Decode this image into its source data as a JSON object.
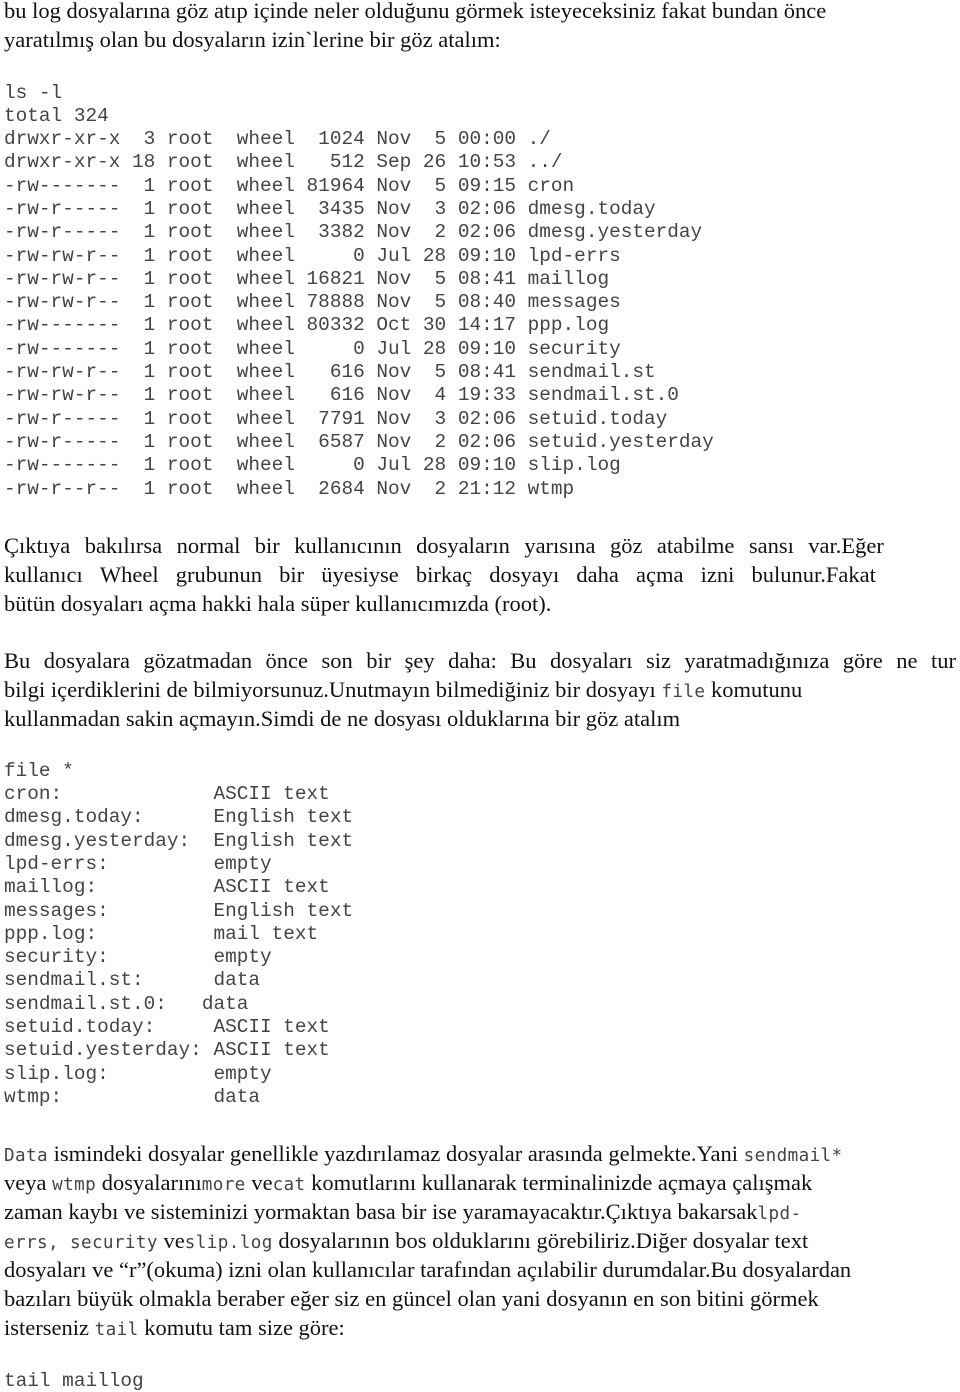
{
  "intro": {
    "line1": "bu log dosyalarına göz atıp içinde neler olduğunu görmek isteyeceksiniz fakat bundan önce",
    "line2": "yaratılmış olan bu dosyaların izin`lerine bir göz atalım:"
  },
  "ls_listing": {
    "command": "ls -l",
    "total": "total 324",
    "rows": [
      {
        "perms": "drwxr-xr-x",
        "links": "3",
        "owner": "root",
        "group": "wheel",
        "size": "1024",
        "month": "Nov",
        "day": "5",
        "time": "00:00",
        "name": "./"
      },
      {
        "perms": "drwxr-xr-x",
        "links": "18",
        "owner": "root",
        "group": "wheel",
        "size": "512",
        "month": "Sep",
        "day": "26",
        "time": "10:53",
        "name": "../"
      },
      {
        "perms": "-rw-------",
        "links": "1",
        "owner": "root",
        "group": "wheel",
        "size": "81964",
        "month": "Nov",
        "day": "5",
        "time": "09:15",
        "name": "cron"
      },
      {
        "perms": "-rw-r-----",
        "links": "1",
        "owner": "root",
        "group": "wheel",
        "size": "3435",
        "month": "Nov",
        "day": "3",
        "time": "02:06",
        "name": "dmesg.today"
      },
      {
        "perms": "-rw-r-----",
        "links": "1",
        "owner": "root",
        "group": "wheel",
        "size": "3382",
        "month": "Nov",
        "day": "2",
        "time": "02:06",
        "name": "dmesg.yesterday"
      },
      {
        "perms": "-rw-rw-r--",
        "links": "1",
        "owner": "root",
        "group": "wheel",
        "size": "0",
        "month": "Jul",
        "day": "28",
        "time": "09:10",
        "name": "lpd-errs"
      },
      {
        "perms": "-rw-rw-r--",
        "links": "1",
        "owner": "root",
        "group": "wheel",
        "size": "16821",
        "month": "Nov",
        "day": "5",
        "time": "08:41",
        "name": "maillog"
      },
      {
        "perms": "-rw-rw-r--",
        "links": "1",
        "owner": "root",
        "group": "wheel",
        "size": "78888",
        "month": "Nov",
        "day": "5",
        "time": "08:40",
        "name": "messages"
      },
      {
        "perms": "-rw-------",
        "links": "1",
        "owner": "root",
        "group": "wheel",
        "size": "80332",
        "month": "Oct",
        "day": "30",
        "time": "14:17",
        "name": "ppp.log"
      },
      {
        "perms": "-rw-------",
        "links": "1",
        "owner": "root",
        "group": "wheel",
        "size": "0",
        "month": "Jul",
        "day": "28",
        "time": "09:10",
        "name": "security"
      },
      {
        "perms": "-rw-rw-r--",
        "links": "1",
        "owner": "root",
        "group": "wheel",
        "size": "616",
        "month": "Nov",
        "day": "5",
        "time": "08:41",
        "name": "sendmail.st"
      },
      {
        "perms": "-rw-rw-r--",
        "links": "1",
        "owner": "root",
        "group": "wheel",
        "size": "616",
        "month": "Nov",
        "day": "4",
        "time": "19:33",
        "name": "sendmail.st.0"
      },
      {
        "perms": "-rw-r-----",
        "links": "1",
        "owner": "root",
        "group": "wheel",
        "size": "7791",
        "month": "Nov",
        "day": "3",
        "time": "02:06",
        "name": "setuid.today"
      },
      {
        "perms": "-rw-r-----",
        "links": "1",
        "owner": "root",
        "group": "wheel",
        "size": "6587",
        "month": "Nov",
        "day": "2",
        "time": "02:06",
        "name": "setuid.yesterday"
      },
      {
        "perms": "-rw-------",
        "links": "1",
        "owner": "root",
        "group": "wheel",
        "size": "0",
        "month": "Jul",
        "day": "28",
        "time": "09:10",
        "name": "slip.log"
      },
      {
        "perms": "-rw-r--r--",
        "links": "1",
        "owner": "root",
        "group": "wheel",
        "size": "2684",
        "month": "Nov",
        "day": "2",
        "time": "21:12",
        "name": "wtmp"
      }
    ]
  },
  "para1": {
    "line1": [
      "Çıktıya",
      "bakılırsa",
      "normal",
      "bir",
      "kullanıcının",
      "dosyaların",
      "yarısına",
      "göz",
      "atabilme",
      "sansı",
      "var.Eğer"
    ],
    "line2": [
      "kullanıcı",
      "Wheel",
      "grubunun",
      "bir",
      "üyesiyse",
      "birkaç",
      "dosyayı",
      "daha",
      "açma",
      "izni",
      "bulunur.Fakat"
    ],
    "line3": "bütün dosyaları açma hakki hala süper kullanıcımızda (root)."
  },
  "para2": {
    "line1": [
      "Bu",
      "dosyalara",
      "gözatmadan",
      "önce",
      "son",
      "bir",
      "şey",
      "daha:",
      "Bu",
      "dosyaları",
      "siz",
      "yaratmadığınıza",
      "göre",
      "ne",
      "tur"
    ],
    "line2_a": "bilgi içerdiklerini de bilmiyorsunuz.Unutmayın bilmediğiniz bir dosyayı ",
    "line2_code": "file",
    "line2_b": " komutunu",
    "line3": "kullanmadan sakin açmayın.Simdi de ne dosyası olduklarına bir göz atalım"
  },
  "file_listing": {
    "command": "file *",
    "rows": [
      {
        "name": "cron:",
        "type": "ASCII text"
      },
      {
        "name": "dmesg.today:",
        "type": "English text"
      },
      {
        "name": "dmesg.yesterday:",
        "type": "English text"
      },
      {
        "name": "lpd-errs:",
        "type": "empty"
      },
      {
        "name": "maillog:",
        "type": "ASCII text"
      },
      {
        "name": "messages:",
        "type": "English text"
      },
      {
        "name": "ppp.log:",
        "type": "mail text"
      },
      {
        "name": "security:",
        "type": "empty"
      },
      {
        "name": "sendmail.st:",
        "type": "data"
      },
      {
        "name": "sendmail.st.0:",
        "type": "data"
      },
      {
        "name": "setuid.today:",
        "type": "ASCII text"
      },
      {
        "name": "setuid.yesterday:",
        "type": "ASCII text"
      },
      {
        "name": "slip.log:",
        "type": "empty"
      },
      {
        "name": "wtmp:",
        "type": "data"
      }
    ]
  },
  "para3": {
    "l1_code1": "Data",
    "l1_text": " ismindeki dosyalar genellikle yazdırılamaz dosyalar arasında gelmekte.Yani ",
    "l1_code2": "sendmail*",
    "l2_text1": "veya ",
    "l2_code1": "wtmp",
    "l2_text2": " dosyalarını",
    "l2_code2": "more",
    "l2_text3": " ve",
    "l2_code3": "cat",
    "l2_text4": " komutlarını kullanarak terminalinizde açmaya çalışmak",
    "l3_text": "zaman kaybı ve sisteminizi yormaktan basa bir ise yaramayacaktır.Çıktıya bakarsak",
    "l3_code": "lpd-",
    "l4_code1": "errs, security",
    "l4_text1": " ve",
    "l4_code2": "slip.log",
    "l4_text2": " dosyalarının bos olduklarını görebiliriz.Diğer dosyalar text",
    "l5": "dosyaları ve “r”(okuma) izni olan kullanıcılar tarafından açılabilir durumdalar.Bu dosyalardan",
    "l6": "bazıları büyük olmakla beraber eğer siz en güncel olan yani dosyanın en son bitini görmek",
    "l7_text": "isterseniz ",
    "l7_code": "tail",
    "l7_text2": " komutu tam size göre:"
  },
  "tail_command": "tail maillog"
}
